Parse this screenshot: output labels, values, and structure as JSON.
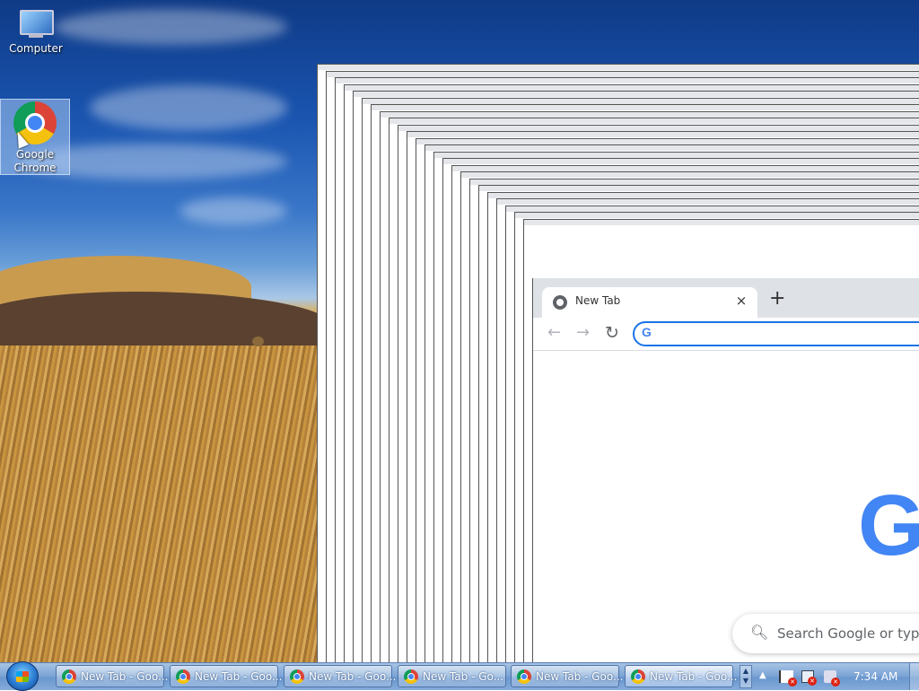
{
  "desktop": {
    "icons": [
      {
        "label": "Computer"
      },
      {
        "label": "Google Chrome"
      }
    ]
  },
  "browser": {
    "tab_title": "New Tab",
    "tab_close": "×",
    "new_tab": "+",
    "nav": {
      "back": "←",
      "forward": "→",
      "reload": "↻"
    },
    "omnibox_logo": "G",
    "google_logo_partial": "G",
    "search_placeholder": "Search Google or type"
  },
  "taskbar": {
    "buttons": [
      {
        "label": "New Tab - Goo..."
      },
      {
        "label": "New Tab - Goo..."
      },
      {
        "label": "New Tab - Goo..."
      },
      {
        "label": "New Tab - Go..."
      },
      {
        "label": "New Tab - Goo..."
      },
      {
        "label": "New Tab - Goo..."
      }
    ],
    "clock": "7:34 AM"
  },
  "colors": {
    "accent": "#1a73e8",
    "google_blue": "#4285f4"
  }
}
